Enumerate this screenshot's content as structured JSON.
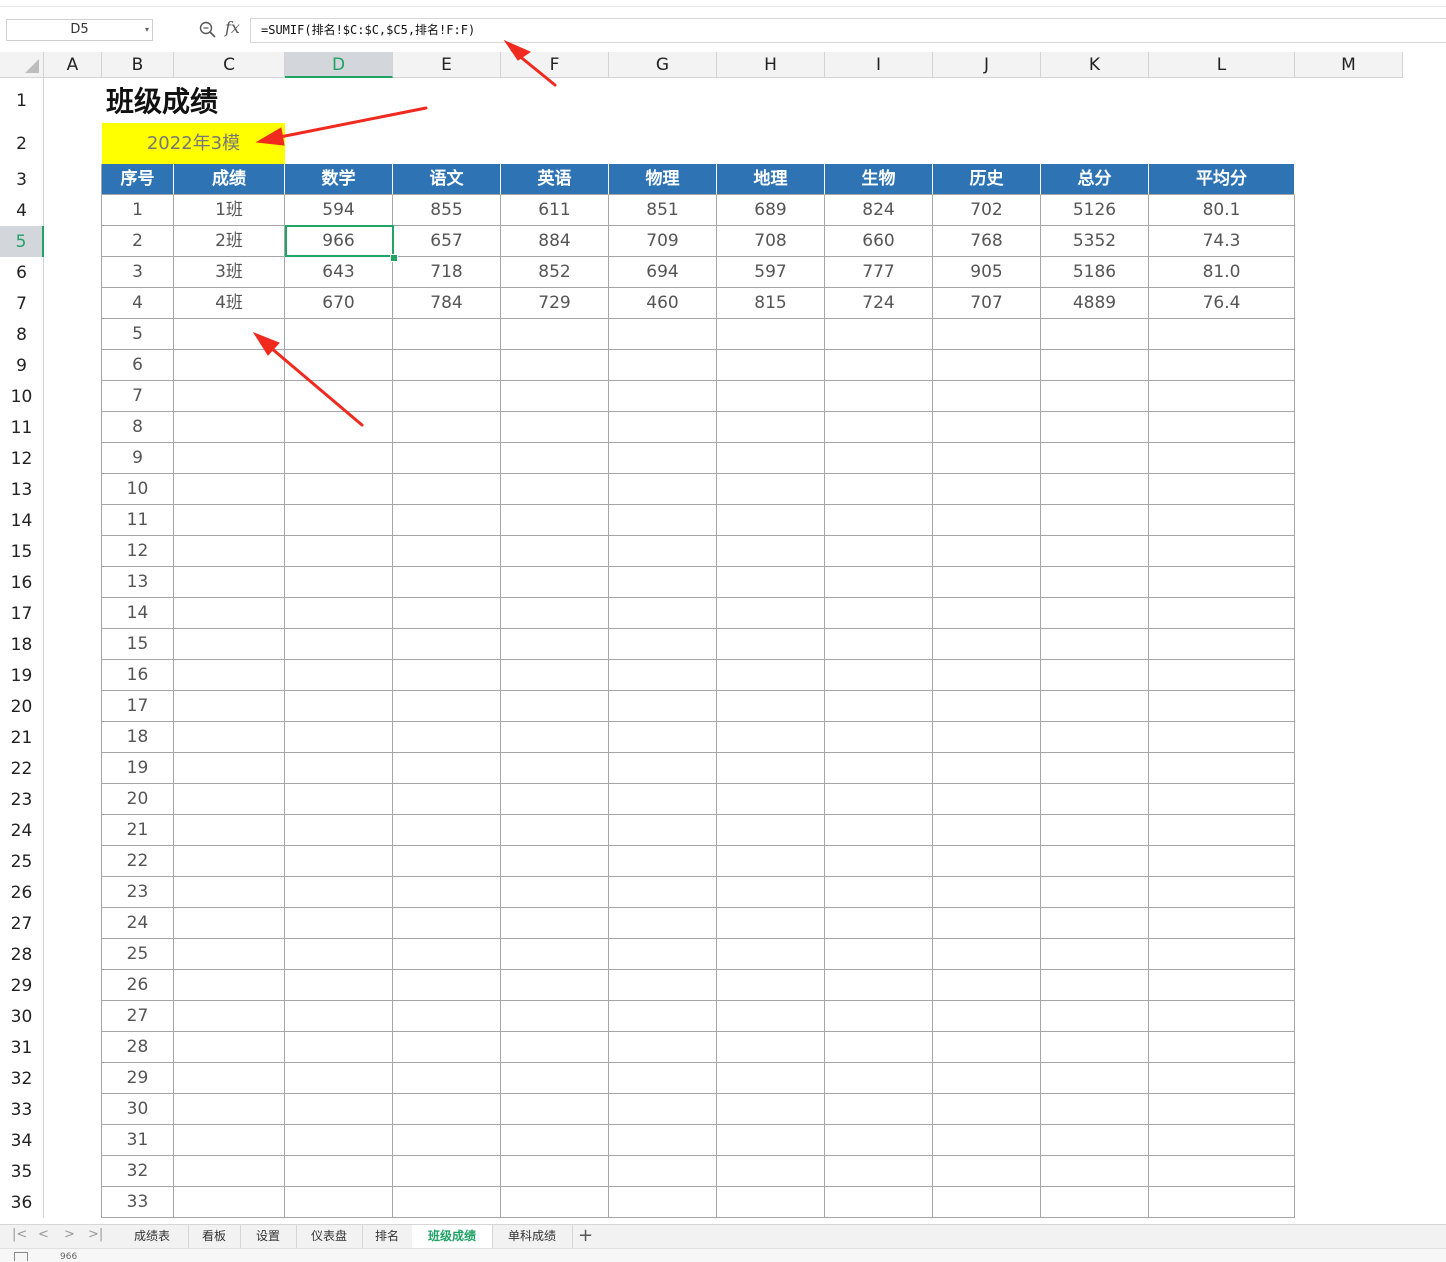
{
  "formula_bar": {
    "cell_ref": "D5",
    "formula": "=SUMIF(排名!$C:$C,$C5,排名!F:F)"
  },
  "columns": [
    "A",
    "B",
    "C",
    "D",
    "E",
    "F",
    "G",
    "H",
    "I",
    "J",
    "K",
    "L",
    "M"
  ],
  "selected_column": "D",
  "selected_row": 5,
  "rows_visible": 36,
  "sheet": {
    "title": "班级成绩",
    "subtitle": "2022年3模",
    "headers": [
      "序号",
      "成绩",
      "数学",
      "语文",
      "英语",
      "物理",
      "地理",
      "生物",
      "历史",
      "总分",
      "平均分"
    ],
    "data": [
      [
        "1",
        "1班",
        "594",
        "855",
        "611",
        "851",
        "689",
        "824",
        "702",
        "5126",
        "80.1"
      ],
      [
        "2",
        "2班",
        "966",
        "657",
        "884",
        "709",
        "708",
        "660",
        "768",
        "5352",
        "74.3"
      ],
      [
        "3",
        "3班",
        "643",
        "718",
        "852",
        "694",
        "597",
        "777",
        "905",
        "5186",
        "81.0"
      ],
      [
        "4",
        "4班",
        "670",
        "784",
        "729",
        "460",
        "815",
        "724",
        "707",
        "4889",
        "76.4"
      ]
    ],
    "empty_serials": [
      "5",
      "6",
      "7",
      "8",
      "9",
      "10",
      "11",
      "12",
      "13",
      "14",
      "15",
      "16",
      "17",
      "18",
      "19",
      "20",
      "21",
      "22",
      "23",
      "24",
      "25",
      "26",
      "27",
      "28",
      "29",
      "30",
      "31",
      "32",
      "33"
    ]
  },
  "sheet_tabs": [
    {
      "label": "成绩表",
      "active": false
    },
    {
      "label": "看板",
      "active": false
    },
    {
      "label": "设置",
      "active": false
    },
    {
      "label": "仪表盘",
      "active": false
    },
    {
      "label": "排名",
      "active": false
    },
    {
      "label": "班级成绩",
      "active": true
    },
    {
      "label": "单科成绩",
      "active": false
    }
  ],
  "status_bar": {
    "value": "966"
  },
  "colors": {
    "header_fill": "#2e74b5",
    "subtitle_fill": "#ffff00",
    "accent": "#21a366",
    "arrow": "#f02a1e"
  }
}
